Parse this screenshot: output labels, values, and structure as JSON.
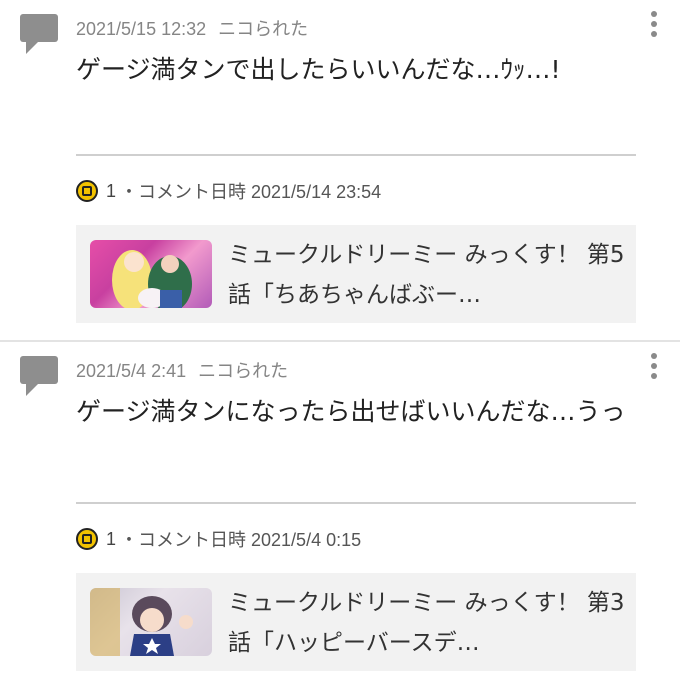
{
  "feed": [
    {
      "timestamp": "2021/5/15 12:32",
      "action": "ニコられた",
      "comment": "ゲージ満タンで出したらいいんだな…ｳｯ…!",
      "nico_count": "1",
      "comment_datetime_label": "・コメント日時 2021/5/14 23:54",
      "video_title": "ミュークルドリーミー みっくす！ 第5話「ちあちゃんばぶー…"
    },
    {
      "timestamp": "2021/5/4 2:41",
      "action": "ニコられた",
      "comment": "ゲージ満タンになったら出せばいいんだな…うっ",
      "nico_count": "1",
      "comment_datetime_label": "・コメント日時 2021/5/4 0:15",
      "video_title": "ミュークルドリーミー みっくす！ 第3話「ハッピーバースデ…"
    }
  ],
  "icons": {
    "comment": "speech-bubble-icon",
    "more": "more-vert-icon",
    "nico": "nico-icon"
  },
  "colors": {
    "meta_text": "#858585",
    "icon_gray": "#8e8e8e",
    "nico_yellow": "#f2c200",
    "video_box_bg": "#f2f2f2"
  }
}
